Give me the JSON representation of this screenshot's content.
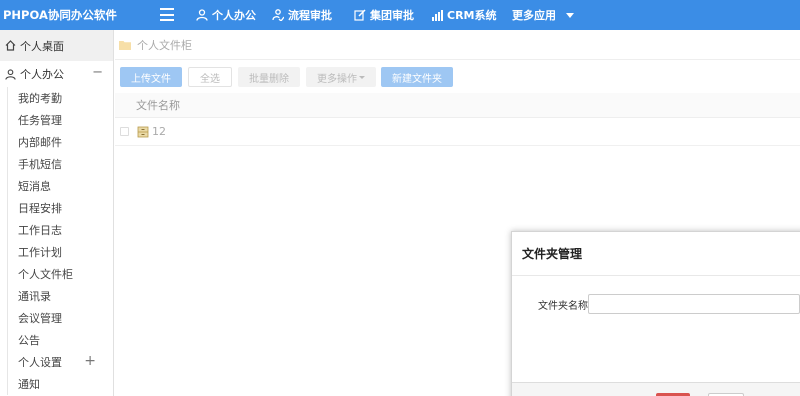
{
  "app": {
    "title": "PHPOA协同办公软件"
  },
  "topnav": {
    "items": [
      {
        "label": "个人办公",
        "icon": "user-icon"
      },
      {
        "label": "流程审批",
        "icon": "workflow-icon"
      },
      {
        "label": "集团审批",
        "icon": "edit-icon"
      },
      {
        "label": "CRM系统",
        "icon": "bar-chart-icon"
      },
      {
        "label": "更多应用",
        "icon": "chevron-down-icon"
      }
    ]
  },
  "sidebar": {
    "home_label": "个人桌面",
    "section_label": "个人办公",
    "section_toggle": "−",
    "items": [
      {
        "label": "我的考勤"
      },
      {
        "label": "任务管理"
      },
      {
        "label": "内部邮件"
      },
      {
        "label": "手机短信"
      },
      {
        "label": "短消息"
      },
      {
        "label": "日程安排"
      },
      {
        "label": "工作日志"
      },
      {
        "label": "工作计划"
      },
      {
        "label": "个人文件柜"
      },
      {
        "label": "通讯录"
      },
      {
        "label": "会议管理"
      },
      {
        "label": "公告"
      },
      {
        "label": "个人设置",
        "toggle": "+"
      },
      {
        "label": "通知"
      }
    ]
  },
  "main": {
    "breadcrumb": "个人文件柜",
    "toolbar": {
      "upload": "上传文件",
      "select_all": "全选",
      "batch_delete": "批量删除",
      "more_actions": "更多操作",
      "new_folder": "新建文件夹"
    },
    "table": {
      "header": "文件名称",
      "rows": [
        {
          "name": "12"
        }
      ]
    }
  },
  "dialog": {
    "title": "文件夹管理",
    "field_label": "文件夹名称",
    "field_value": ""
  },
  "colors": {
    "primary": "#3b8de6",
    "danger": "#d9534f"
  }
}
